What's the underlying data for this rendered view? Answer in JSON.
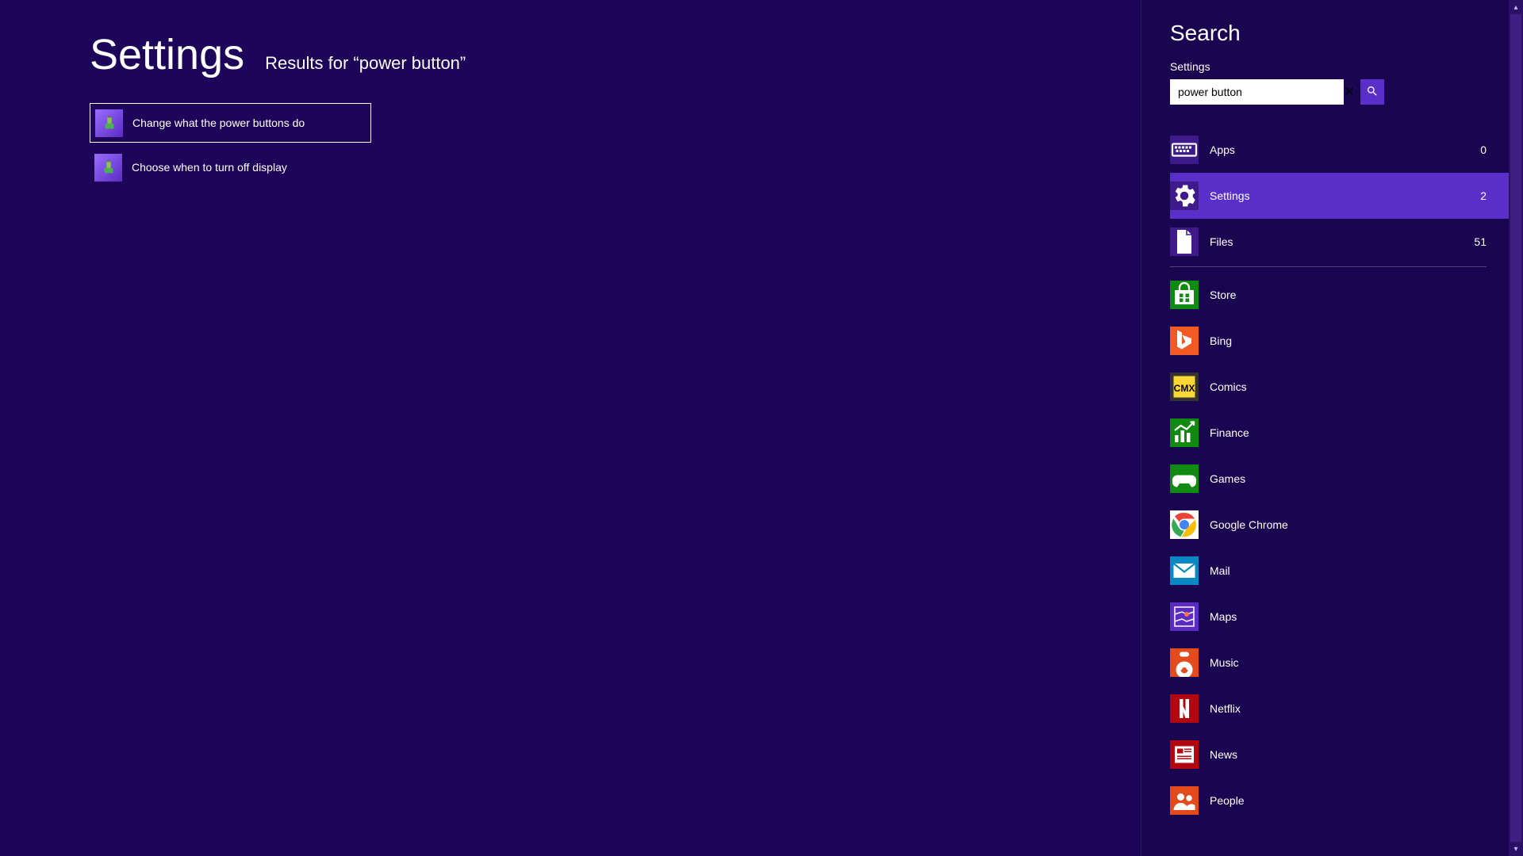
{
  "header": {
    "title": "Settings",
    "results_prefix": "Results for “",
    "query": "power button",
    "results_suffix": "”"
  },
  "results": [
    {
      "label": "Change what the power buttons do",
      "selected": true
    },
    {
      "label": "Choose when to turn off display",
      "selected": false
    }
  ],
  "charm": {
    "title": "Search",
    "context": "Settings",
    "input_value": "power button"
  },
  "scopes1": [
    {
      "name": "Apps",
      "count": "0",
      "active": false,
      "iconBg": "#3e1a8a",
      "icon": "apps"
    },
    {
      "name": "Settings",
      "count": "2",
      "active": true,
      "iconBg": "#3e1a8a",
      "icon": "gear"
    },
    {
      "name": "Files",
      "count": "51",
      "active": false,
      "iconBg": "#3e1a8a",
      "icon": "file"
    }
  ],
  "scopes2": [
    {
      "name": "Store",
      "iconBg": "#108a10",
      "icon": "store"
    },
    {
      "name": "Bing",
      "iconBg": "#f15a22",
      "icon": "bing"
    },
    {
      "name": "Comics",
      "iconBg": "#333333",
      "icon": "comics"
    },
    {
      "name": "Finance",
      "iconBg": "#108a10",
      "icon": "finance"
    },
    {
      "name": "Games",
      "iconBg": "#108a10",
      "icon": "games"
    },
    {
      "name": "Google Chrome",
      "iconBg": "#ffffff",
      "icon": "chrome"
    },
    {
      "name": "Mail",
      "iconBg": "#0a88c4",
      "icon": "mail"
    },
    {
      "name": "Maps",
      "iconBg": "#5b2cc3",
      "icon": "maps"
    },
    {
      "name": "Music",
      "iconBg": "#e34a1c",
      "icon": "music"
    },
    {
      "name": "Netflix",
      "iconBg": "#b20610",
      "icon": "netflix"
    },
    {
      "name": "News",
      "iconBg": "#b20610",
      "icon": "news"
    },
    {
      "name": "People",
      "iconBg": "#e34a1c",
      "icon": "people"
    }
  ]
}
